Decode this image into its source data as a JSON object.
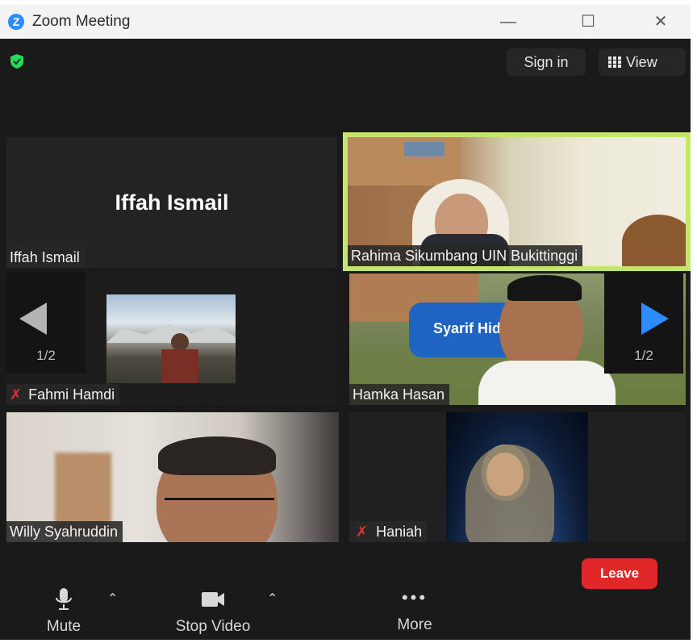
{
  "window": {
    "title": "Zoom Meeting",
    "app_icon_letter": "Z"
  },
  "header": {
    "sign_in_label": "Sign in",
    "view_label": "View",
    "shield_color": "#23d959"
  },
  "tiles": [
    {
      "name": "Iffah Ismail",
      "big_name": "Iffah Ismail",
      "video": false,
      "active_speaker": false
    },
    {
      "name": "Rahima Sikumbang UIN Bukittinggi",
      "video": true,
      "active_speaker": true,
      "highlight_color": "#c3e66b"
    },
    {
      "name": "Fahmi Hamdi",
      "video": true,
      "muted": true
    },
    {
      "name": "Hamka Hasan",
      "video": true,
      "background_sign": "Syarif Hid"
    },
    {
      "name": "Willy Syahruddin",
      "video": true
    },
    {
      "name": "Haniah",
      "video": true,
      "muted": true
    }
  ],
  "pagination": {
    "left_label": "1/2",
    "right_label": "1/2",
    "right_arrow_color": "#2d8cff"
  },
  "controls": {
    "mute_label": "Mute",
    "stop_video_label": "Stop Video",
    "more_label": "More",
    "leave_label": "Leave",
    "leave_color": "#e02828"
  }
}
